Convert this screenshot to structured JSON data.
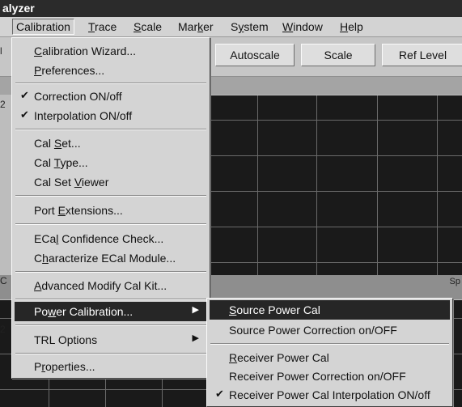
{
  "window": {
    "title": "alyzer"
  },
  "menubar": [
    {
      "pre": "",
      "key": "",
      "post": "Calibration"
    },
    {
      "pre": "",
      "key": "T",
      "post": "race"
    },
    {
      "pre": "",
      "key": "S",
      "post": "cale"
    },
    {
      "pre": "Mar",
      "key": "k",
      "post": "er"
    },
    {
      "pre": "S",
      "key": "y",
      "post": "stem"
    },
    {
      "pre": "",
      "key": "W",
      "post": "indow"
    },
    {
      "pre": "",
      "key": "H",
      "post": "elp"
    }
  ],
  "toolbar": {
    "autoscale": "Autoscale",
    "scale": "Scale",
    "ref_level": "Ref Level"
  },
  "calibration_menu": {
    "calibration_wizard": {
      "pre": "",
      "key": "C",
      "post": "alibration Wizard..."
    },
    "preferences": {
      "pre": "",
      "key": "P",
      "post": "references..."
    },
    "correction": {
      "pre": "Correction ON/off",
      "key": "",
      "post": ""
    },
    "interpolation": {
      "pre": "Interpolation ON/off",
      "key": "",
      "post": ""
    },
    "cal_set": {
      "pre": "Cal ",
      "key": "S",
      "post": "et..."
    },
    "cal_type": {
      "pre": "Cal ",
      "key": "T",
      "post": "ype..."
    },
    "cal_set_viewer": {
      "pre": "Cal Set ",
      "key": "V",
      "post": "iewer"
    },
    "port_extensions": {
      "pre": "Port ",
      "key": "E",
      "post": "xtensions..."
    },
    "ecal_confidence": {
      "pre": "ECa",
      "key": "l",
      "post": " Confidence Check..."
    },
    "characterize_ecal": {
      "pre": "C",
      "key": "h",
      "post": "aracterize ECal Module..."
    },
    "advanced_modify": {
      "pre": "",
      "key": "A",
      "post": "dvanced Modify Cal Kit..."
    },
    "power_calibration": {
      "pre": "Po",
      "key": "w",
      "post": "er Calibration..."
    },
    "trl_options": {
      "pre": "TRL Options",
      "key": "",
      "post": ""
    },
    "properties": {
      "pre": "P",
      "key": "r",
      "post": "operties..."
    }
  },
  "power_submenu": {
    "source_power_cal": {
      "pre": "",
      "key": "S",
      "post": "ource Power Cal"
    },
    "source_power_correction": {
      "pre": "Source Power Correction on/OFF",
      "key": "",
      "post": ""
    },
    "receiver_power_cal": {
      "pre": "",
      "key": "R",
      "post": "eceiver Power Cal"
    },
    "receiver_power_correction": {
      "pre": "Receiver Power Correction on/OFF",
      "key": "",
      "post": ""
    },
    "receiver_power_cal_interp": {
      "pre": "Receiver Power Cal Interpolation ON/off",
      "key": "",
      "post": ""
    }
  },
  "icons": {
    "check": "✔",
    "submenu_arrow": "▶"
  },
  "left_marks": [
    "l",
    "2",
    "C",
    "2"
  ],
  "right_marks": [
    "Sp"
  ],
  "colors": {
    "highlight": "#262626",
    "grid_bg": "#1a1a1a",
    "title_bg": "#2b2b2b"
  }
}
